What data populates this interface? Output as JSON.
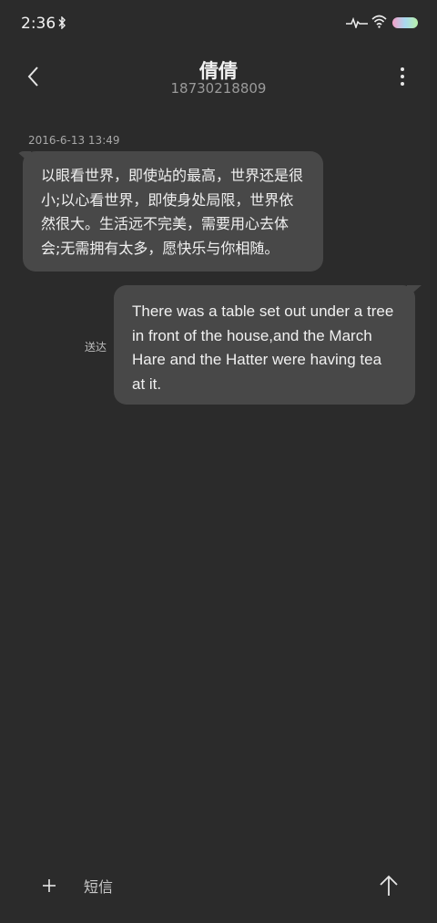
{
  "status_bar": {
    "time": "2:36",
    "icons": [
      "bluetooth-icon",
      "activity-icon",
      "wifi-icon",
      "battery-icon"
    ]
  },
  "header": {
    "contact_name": "倩倩",
    "contact_number": "18730218809",
    "icons": [
      "chevron-left-icon",
      "more-vert-icon"
    ]
  },
  "conversation": {
    "timestamp": "2016-6-13 13:49",
    "incoming_lines": [
      "以眼看世界，即使站的最高，世界还是很",
      "小;以心看世界，即使身处局限，世界依",
      "然很大。生活远不完美，需要用心去体",
      "会;无需拥有太多，愿快乐与你相随。"
    ],
    "outgoing_lines": [
      "There was a table set out under a tree",
      "in front of the house,and the March",
      "Hare and the Hatter were having tea",
      "at it."
    ],
    "outgoing_status": "送达"
  },
  "composer": {
    "placeholder": "短信",
    "icons": [
      "plus-icon",
      "arrow-up-icon"
    ]
  },
  "colors": {
    "background": "#2b2b2b",
    "bubble": "#484848",
    "text": "#f0f0f0",
    "muted": "#9a9a9a"
  }
}
